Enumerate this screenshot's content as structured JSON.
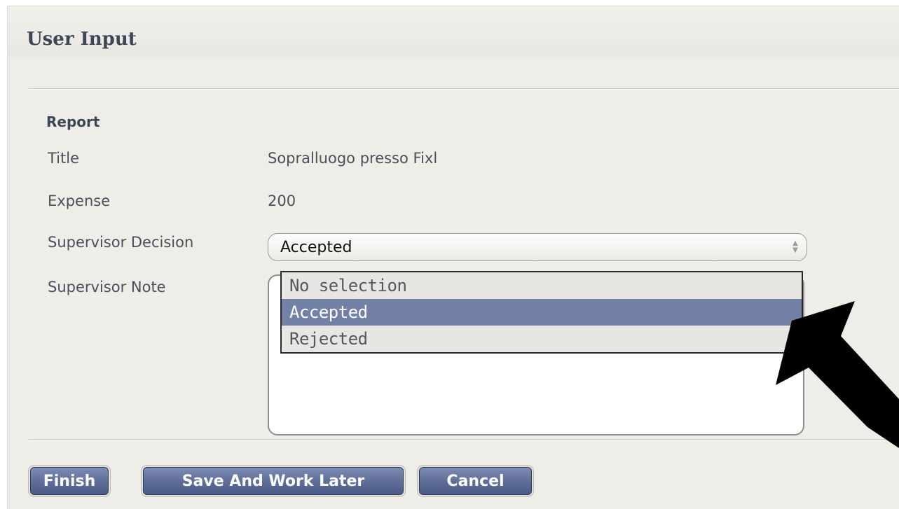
{
  "panel": {
    "title": "User Input"
  },
  "report": {
    "section_title": "Report",
    "fields": [
      {
        "label": "Title",
        "value": "Sopralluogo presso Fixl"
      },
      {
        "label": "Expense",
        "value": "200"
      },
      {
        "label": "Supervisor Decision",
        "value": "Accepted"
      },
      {
        "label": "Supervisor Note",
        "value": ""
      }
    ]
  },
  "dropdown": {
    "options": [
      "No selection",
      "Accepted",
      "Rejected"
    ],
    "selected": "Accepted"
  },
  "buttons": {
    "finish": "Finish",
    "save_later": "Save And Work Later",
    "cancel": "Cancel"
  },
  "annotation": {
    "icon": "pointer-arrow-icon",
    "color": "#000000"
  },
  "colors": {
    "panel_bg": "#efede8",
    "selected_option": "#7481a7",
    "button": "#5d6d97"
  }
}
